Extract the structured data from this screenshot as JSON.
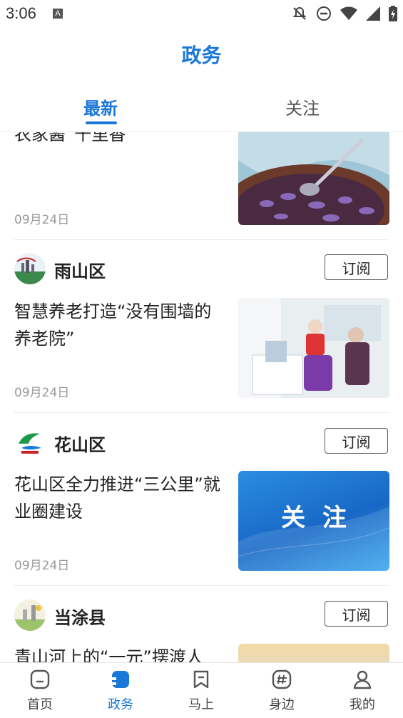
{
  "status_bar": {
    "time": "3:06"
  },
  "header": {
    "title": "政务"
  },
  "tabs": [
    {
      "label": "最新"
    },
    {
      "label": "关注"
    }
  ],
  "articles": [
    {
      "title": "农家酱“千里香”",
      "date": "09月24日",
      "image": "purple-sauce-photo"
    },
    {
      "source": "雨山区",
      "subscribe_label": "订阅",
      "title": "智慧养老打造“没有围墙的养老院”",
      "date": "09月24日",
      "image": "elderly-care-photo"
    },
    {
      "source": "花山区",
      "subscribe_label": "订阅",
      "title": "花山区全力推进“三公里”就业圈建设",
      "date": "09月24日",
      "image_text": "关  注"
    },
    {
      "source": "当涂县",
      "subscribe_label": "订阅",
      "title": "青山河上的“一元”摆渡人",
      "image": "river-photo"
    }
  ],
  "bottom_nav": [
    {
      "label": "首页",
      "icon": "home-icon"
    },
    {
      "label": "政务",
      "icon": "government-icon",
      "active": true
    },
    {
      "label": "马上",
      "icon": "bookmark-icon"
    },
    {
      "label": "身边",
      "icon": "hashtag-icon"
    },
    {
      "label": "我的",
      "icon": "user-icon"
    }
  ],
  "colors": {
    "accent": "#1a78d9"
  }
}
